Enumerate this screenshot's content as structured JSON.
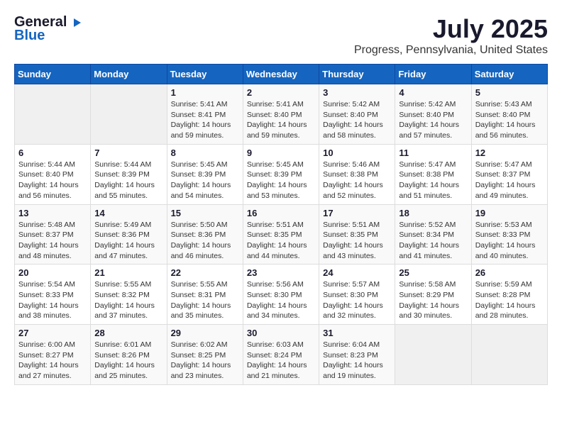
{
  "header": {
    "logo_general": "General",
    "logo_blue": "Blue",
    "month": "July 2025",
    "location": "Progress, Pennsylvania, United States"
  },
  "calendar": {
    "days_of_week": [
      "Sunday",
      "Monday",
      "Tuesday",
      "Wednesday",
      "Thursday",
      "Friday",
      "Saturday"
    ],
    "weeks": [
      [
        {
          "day": "",
          "info": ""
        },
        {
          "day": "",
          "info": ""
        },
        {
          "day": "1",
          "info": "Sunrise: 5:41 AM\nSunset: 8:41 PM\nDaylight: 14 hours and 59 minutes."
        },
        {
          "day": "2",
          "info": "Sunrise: 5:41 AM\nSunset: 8:40 PM\nDaylight: 14 hours and 59 minutes."
        },
        {
          "day": "3",
          "info": "Sunrise: 5:42 AM\nSunset: 8:40 PM\nDaylight: 14 hours and 58 minutes."
        },
        {
          "day": "4",
          "info": "Sunrise: 5:42 AM\nSunset: 8:40 PM\nDaylight: 14 hours and 57 minutes."
        },
        {
          "day": "5",
          "info": "Sunrise: 5:43 AM\nSunset: 8:40 PM\nDaylight: 14 hours and 56 minutes."
        }
      ],
      [
        {
          "day": "6",
          "info": "Sunrise: 5:44 AM\nSunset: 8:40 PM\nDaylight: 14 hours and 56 minutes."
        },
        {
          "day": "7",
          "info": "Sunrise: 5:44 AM\nSunset: 8:39 PM\nDaylight: 14 hours and 55 minutes."
        },
        {
          "day": "8",
          "info": "Sunrise: 5:45 AM\nSunset: 8:39 PM\nDaylight: 14 hours and 54 minutes."
        },
        {
          "day": "9",
          "info": "Sunrise: 5:45 AM\nSunset: 8:39 PM\nDaylight: 14 hours and 53 minutes."
        },
        {
          "day": "10",
          "info": "Sunrise: 5:46 AM\nSunset: 8:38 PM\nDaylight: 14 hours and 52 minutes."
        },
        {
          "day": "11",
          "info": "Sunrise: 5:47 AM\nSunset: 8:38 PM\nDaylight: 14 hours and 51 minutes."
        },
        {
          "day": "12",
          "info": "Sunrise: 5:47 AM\nSunset: 8:37 PM\nDaylight: 14 hours and 49 minutes."
        }
      ],
      [
        {
          "day": "13",
          "info": "Sunrise: 5:48 AM\nSunset: 8:37 PM\nDaylight: 14 hours and 48 minutes."
        },
        {
          "day": "14",
          "info": "Sunrise: 5:49 AM\nSunset: 8:36 PM\nDaylight: 14 hours and 47 minutes."
        },
        {
          "day": "15",
          "info": "Sunrise: 5:50 AM\nSunset: 8:36 PM\nDaylight: 14 hours and 46 minutes."
        },
        {
          "day": "16",
          "info": "Sunrise: 5:51 AM\nSunset: 8:35 PM\nDaylight: 14 hours and 44 minutes."
        },
        {
          "day": "17",
          "info": "Sunrise: 5:51 AM\nSunset: 8:35 PM\nDaylight: 14 hours and 43 minutes."
        },
        {
          "day": "18",
          "info": "Sunrise: 5:52 AM\nSunset: 8:34 PM\nDaylight: 14 hours and 41 minutes."
        },
        {
          "day": "19",
          "info": "Sunrise: 5:53 AM\nSunset: 8:33 PM\nDaylight: 14 hours and 40 minutes."
        }
      ],
      [
        {
          "day": "20",
          "info": "Sunrise: 5:54 AM\nSunset: 8:33 PM\nDaylight: 14 hours and 38 minutes."
        },
        {
          "day": "21",
          "info": "Sunrise: 5:55 AM\nSunset: 8:32 PM\nDaylight: 14 hours and 37 minutes."
        },
        {
          "day": "22",
          "info": "Sunrise: 5:55 AM\nSunset: 8:31 PM\nDaylight: 14 hours and 35 minutes."
        },
        {
          "day": "23",
          "info": "Sunrise: 5:56 AM\nSunset: 8:30 PM\nDaylight: 14 hours and 34 minutes."
        },
        {
          "day": "24",
          "info": "Sunrise: 5:57 AM\nSunset: 8:30 PM\nDaylight: 14 hours and 32 minutes."
        },
        {
          "day": "25",
          "info": "Sunrise: 5:58 AM\nSunset: 8:29 PM\nDaylight: 14 hours and 30 minutes."
        },
        {
          "day": "26",
          "info": "Sunrise: 5:59 AM\nSunset: 8:28 PM\nDaylight: 14 hours and 28 minutes."
        }
      ],
      [
        {
          "day": "27",
          "info": "Sunrise: 6:00 AM\nSunset: 8:27 PM\nDaylight: 14 hours and 27 minutes."
        },
        {
          "day": "28",
          "info": "Sunrise: 6:01 AM\nSunset: 8:26 PM\nDaylight: 14 hours and 25 minutes."
        },
        {
          "day": "29",
          "info": "Sunrise: 6:02 AM\nSunset: 8:25 PM\nDaylight: 14 hours and 23 minutes."
        },
        {
          "day": "30",
          "info": "Sunrise: 6:03 AM\nSunset: 8:24 PM\nDaylight: 14 hours and 21 minutes."
        },
        {
          "day": "31",
          "info": "Sunrise: 6:04 AM\nSunset: 8:23 PM\nDaylight: 14 hours and 19 minutes."
        },
        {
          "day": "",
          "info": ""
        },
        {
          "day": "",
          "info": ""
        }
      ]
    ]
  }
}
